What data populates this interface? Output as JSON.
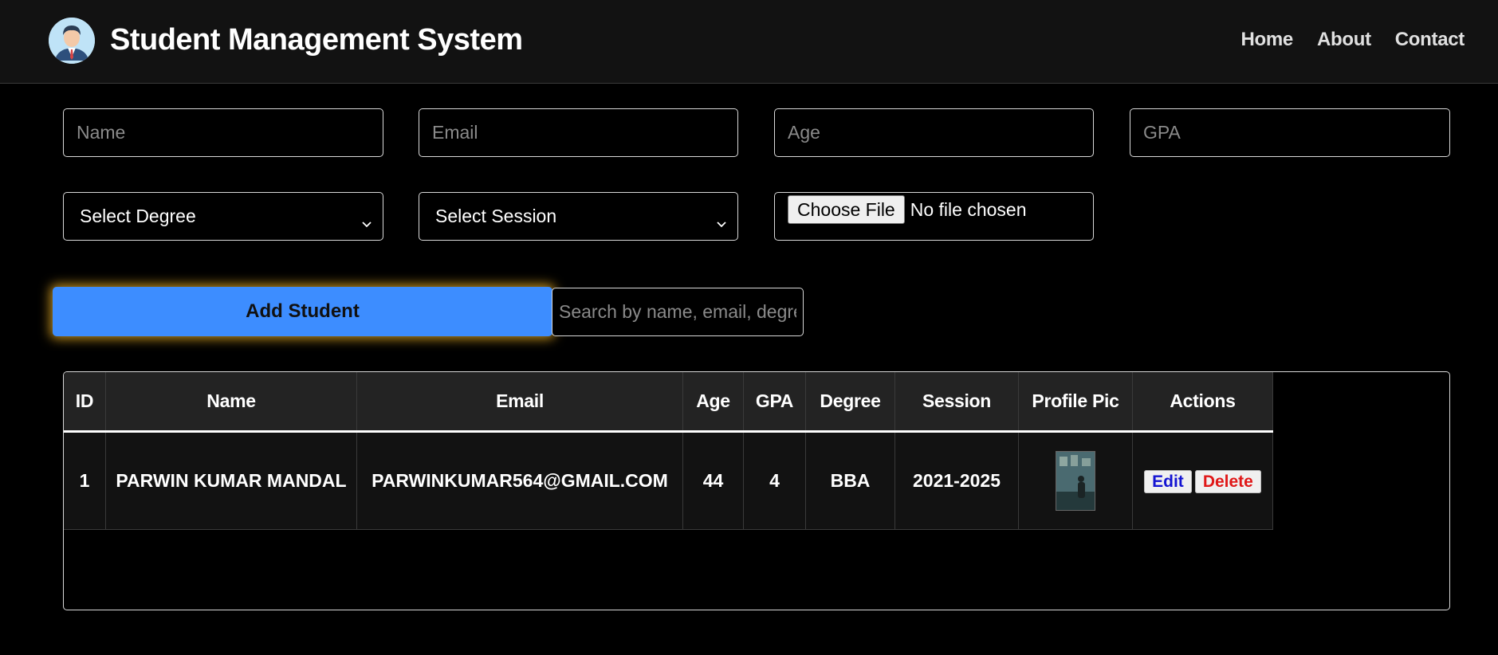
{
  "header": {
    "title": "Student Management System",
    "logo_icon": "student-avatar-icon",
    "nav": [
      {
        "label": "Home"
      },
      {
        "label": "About"
      },
      {
        "label": "Contact"
      }
    ]
  },
  "form": {
    "name_placeholder": "Name",
    "email_placeholder": "Email",
    "age_placeholder": "Age",
    "gpa_placeholder": "GPA",
    "degree_selected": "Select Degree",
    "session_selected": "Select Session",
    "file_button": "Choose File",
    "file_status": "No file chosen",
    "add_button": "Add Student",
    "search_placeholder": "Search by name, email, degree..."
  },
  "table": {
    "columns": [
      "ID",
      "Name",
      "Email",
      "Age",
      "GPA",
      "Degree",
      "Session",
      "Profile Pic",
      "Actions"
    ],
    "rows": [
      {
        "id": "1",
        "name": "PARWIN KUMAR MANDAL",
        "email": "PARWINKUMAR564@GMAIL.COM",
        "age": "44",
        "gpa": "4",
        "degree": "BBA",
        "session": "2021-2025",
        "edit_label": "Edit",
        "delete_label": "Delete"
      }
    ]
  },
  "colors": {
    "accent": "#3d8dff",
    "glow": "#ffbe28",
    "header_bg": "#121212",
    "edit_text": "#1414d2",
    "delete_text": "#e01818"
  }
}
